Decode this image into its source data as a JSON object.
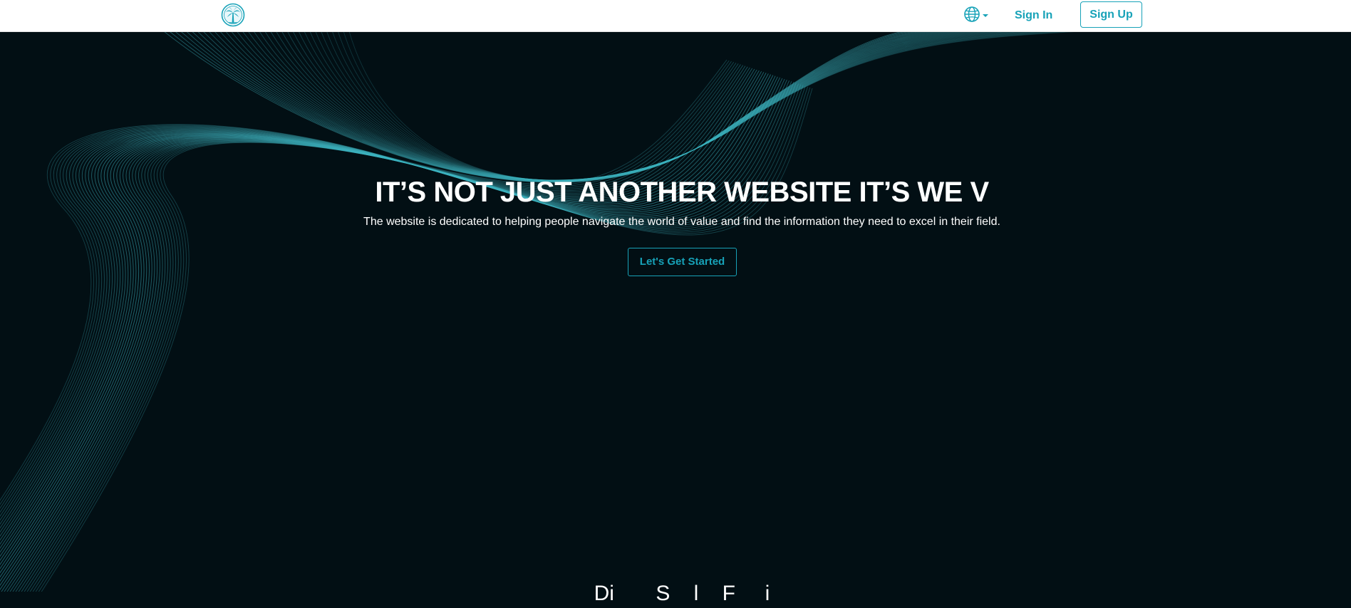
{
  "nav": {
    "logo_icon": "palm-tree-logo-icon",
    "language_icon": "globe-icon",
    "sign_in": "Sign In",
    "sign_up": "Sign Up"
  },
  "hero": {
    "headline": "IT’S NOT JUST ANOTHER WEBSITE IT’S WE V",
    "subline": "The website is dedicated to helping people navigate the world of value and find the information they need to excel in their field.",
    "cta": "Let's Get Started"
  },
  "next_section": {
    "heading_partial": "Di       S    l    F     i"
  },
  "colors": {
    "accent": "#17a2b8",
    "hero_background": "#020f14",
    "wave_lines": "#3fb6c2",
    "navbar_background": "#ffffff"
  }
}
